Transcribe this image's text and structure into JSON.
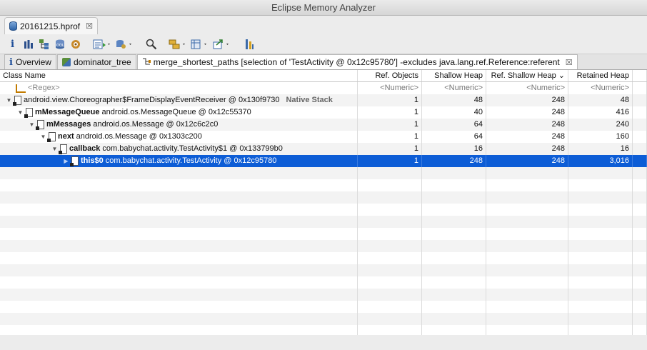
{
  "window": {
    "title": "Eclipse Memory Analyzer"
  },
  "file_tab": {
    "label": "20161215.hprof",
    "close": "☒"
  },
  "toolbar": {
    "icons": [
      "info-icon",
      "histogram-icon",
      "dominator-tree-icon",
      "oql-icon",
      "heap-dump-overview-icon",
      "reports-icon",
      "query-browser-icon",
      "search-icon",
      "group-by-icon",
      "calculate-retained-icon",
      "export-icon",
      "run-expert-icon"
    ]
  },
  "view_tabs": [
    {
      "label": "Overview",
      "icon": "info-icon"
    },
    {
      "label": "dominator_tree",
      "icon": "dominator-tree-icon"
    },
    {
      "label": "merge_shortest_paths [selection of 'TestActivity @ 0x12c95780'] -excludes java.lang.ref.Reference:referent",
      "icon": "merge-paths-icon",
      "close": "☒"
    }
  ],
  "table": {
    "columns": [
      "Class Name",
      "Ref. Objects",
      "Shallow Heap",
      "Ref. Shallow Heap ⌄",
      "Retained Heap"
    ],
    "filter_row": {
      "name": "<Regex>",
      "numeric": "<Numeric>"
    },
    "rows": [
      {
        "field": "",
        "type": "android.view.Choreographer$FrameDisplayEventReceiver @ 0x130f9730",
        "badge": "Native Stack",
        "ref_objects": "1",
        "shallow": "48",
        "ref_shallow": "248",
        "retained": "48"
      },
      {
        "field": "mMessageQueue",
        "type": "android.os.MessageQueue @ 0x12c55370",
        "badge": "",
        "ref_objects": "1",
        "shallow": "40",
        "ref_shallow": "248",
        "retained": "416"
      },
      {
        "field": "mMessages",
        "type": "android.os.Message @ 0x12c6c2c0",
        "badge": "",
        "ref_objects": "1",
        "shallow": "64",
        "ref_shallow": "248",
        "retained": "240"
      },
      {
        "field": "next",
        "type": "android.os.Message @ 0x1303c200",
        "badge": "",
        "ref_objects": "1",
        "shallow": "64",
        "ref_shallow": "248",
        "retained": "160"
      },
      {
        "field": "callback",
        "type": "com.babychat.activity.TestActivity$1 @ 0x133799b0",
        "badge": "",
        "ref_objects": "1",
        "shallow": "16",
        "ref_shallow": "248",
        "retained": "16"
      },
      {
        "field": "this$0",
        "type": "com.babychat.activity.TestActivity @ 0x12c95780",
        "badge": "",
        "ref_objects": "1",
        "shallow": "248",
        "ref_shallow": "248",
        "retained": "3,016"
      }
    ]
  },
  "colors": {
    "selection": "#0d5dd6"
  }
}
